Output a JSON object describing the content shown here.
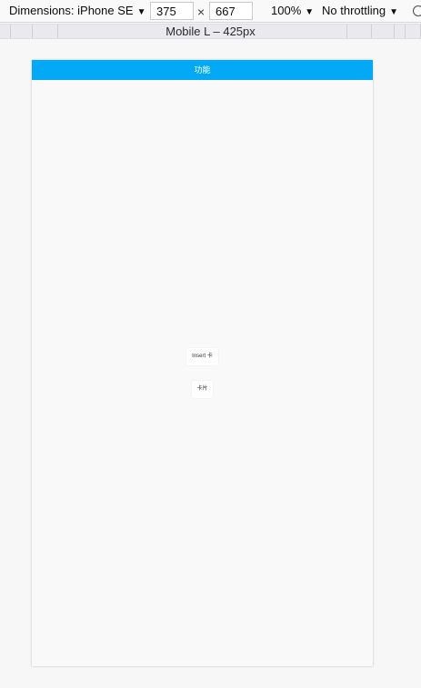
{
  "toolbar": {
    "dimensions_label": "Dimensions: iPhone SE",
    "width_value": "375",
    "times_symbol": "×",
    "height_value": "667",
    "zoom_label": "100%",
    "throttle_label": "No throttling",
    "caret": "▼"
  },
  "media_bar": {
    "label": "Mobile L – 425px"
  },
  "app": {
    "header_title": "功能",
    "button_1": "Insert 卡",
    "button_2": "卡片"
  },
  "colors": {
    "header": "#03a9f4"
  }
}
